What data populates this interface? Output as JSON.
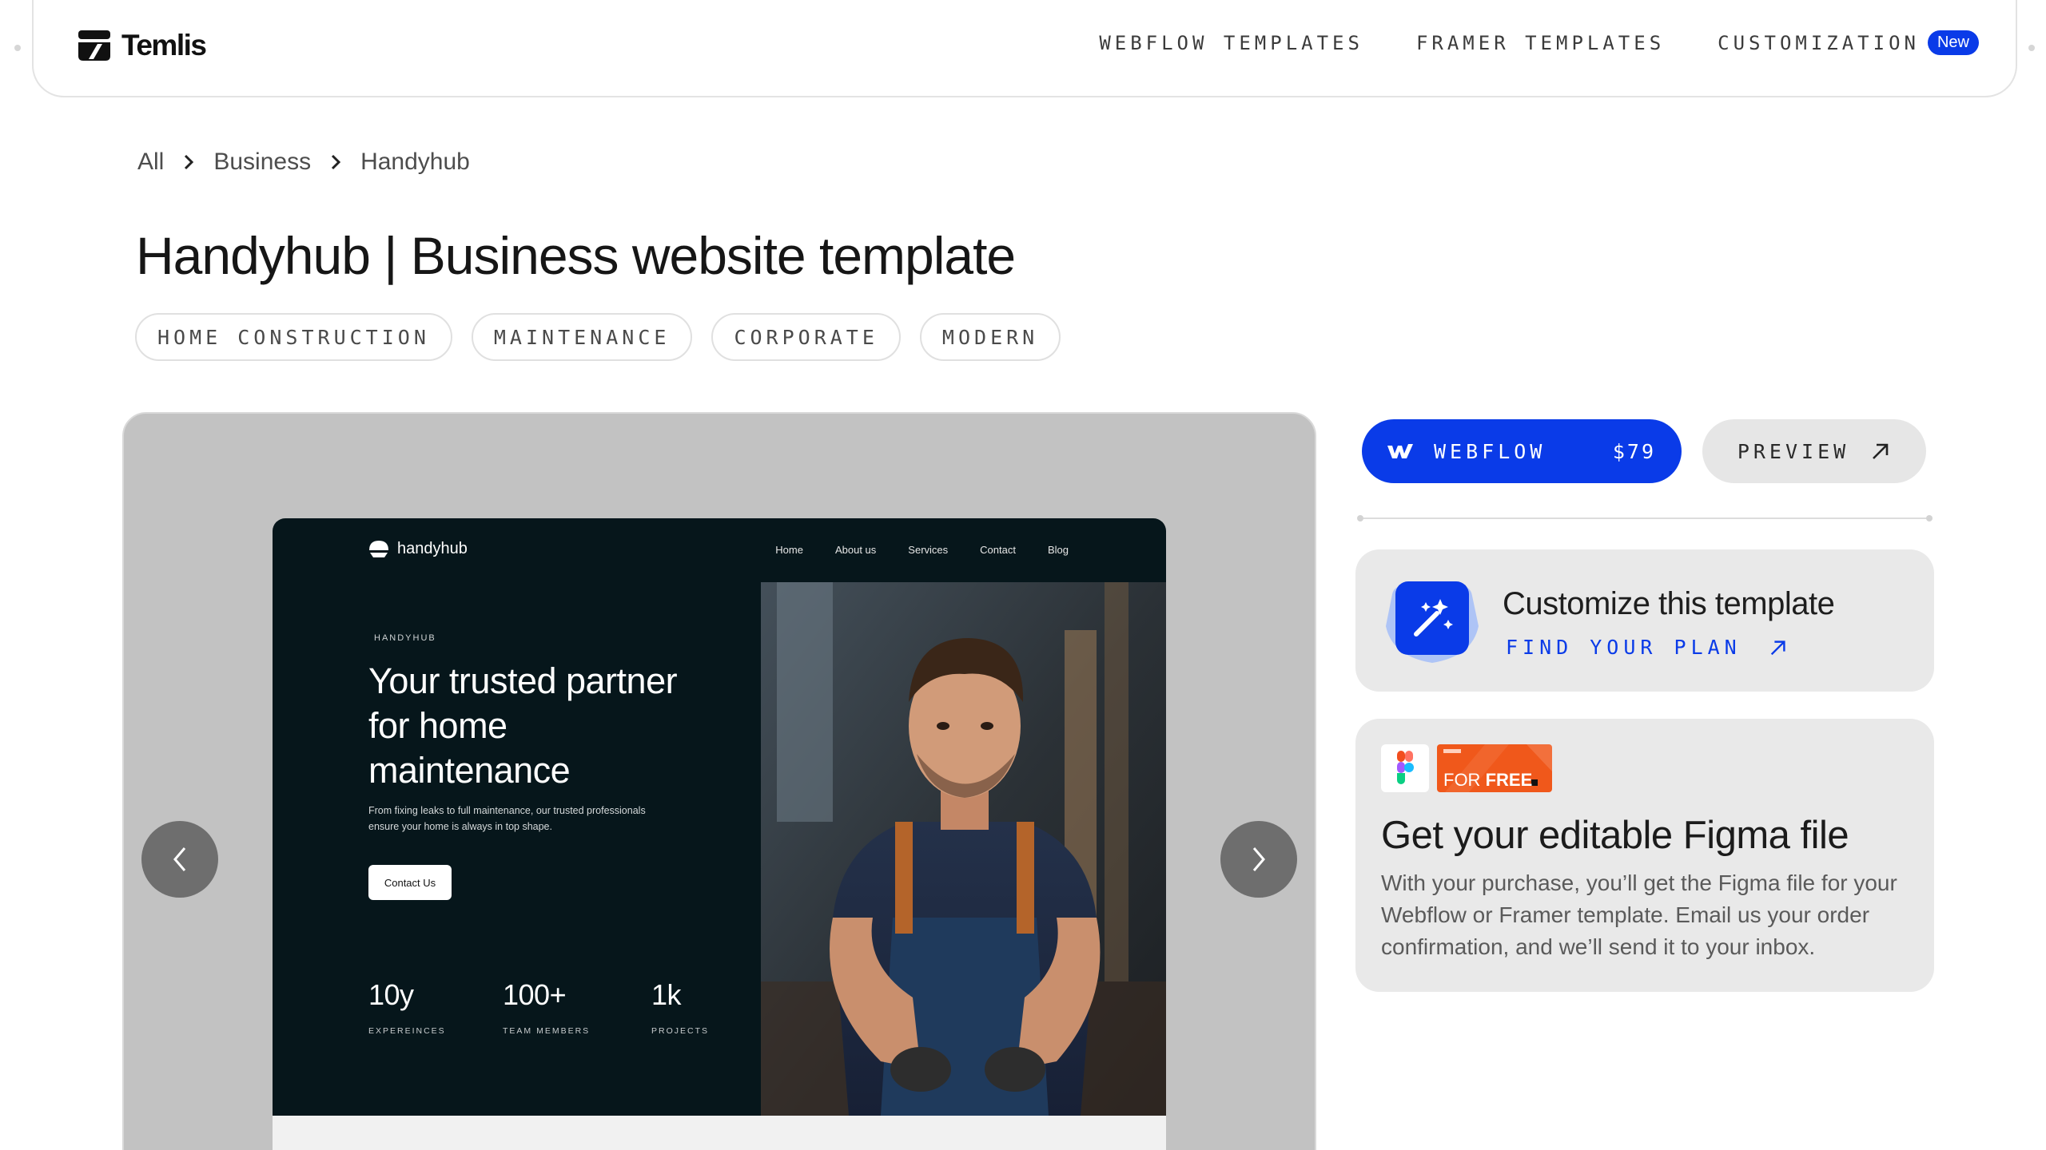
{
  "brand": {
    "name": "Temlis"
  },
  "nav": {
    "links": [
      {
        "label": "WEBFLOW TEMPLATES"
      },
      {
        "label": "FRAMER TEMPLATES"
      },
      {
        "label": "CUSTOMIZATION",
        "badge": "New"
      }
    ]
  },
  "breadcrumb": [
    "All",
    "Business",
    "Handyhub"
  ],
  "page": {
    "title": "Handyhub | Business website template"
  },
  "tags": [
    "HOME CONSTRUCTION",
    "MAINTENANCE",
    "CORPORATE",
    "MODERN"
  ],
  "preview_site": {
    "logo": "handyhub",
    "nav": [
      "Home",
      "About us",
      "Services",
      "Contact",
      "Blog"
    ],
    "eyebrow": "HANDYHUB",
    "headline": "Your trusted partner for home maintenance",
    "body": "From fixing leaks to full maintenance, our trusted professionals ensure your home is always in top shape.",
    "cta": "Contact Us",
    "stats": [
      {
        "value": "10y",
        "label": "EXPEREINCES"
      },
      {
        "value": "100+",
        "label": "TEAM MEMBERS"
      },
      {
        "value": "1k",
        "label": "PROJECTS"
      }
    ]
  },
  "purchase": {
    "platform_label": "WEBFLOW",
    "price": "$79",
    "preview_label": "PREVIEW"
  },
  "customize_card": {
    "title": "Customize this template",
    "link": "FIND YOUR PLAN"
  },
  "figma_card": {
    "tag_prefix": "FOR",
    "tag_emphasis": "FREE",
    "title": "Get your editable Figma file",
    "body": "With your purchase, you’ll get the Figma file for your Webflow or Framer template. Email us your order confirmation, and we’ll send it to your inbox."
  },
  "colors": {
    "accent": "#0a3be8",
    "preview_bg": "#c2c2c2",
    "site_bg": "#06161b",
    "card_bg": "#e9e9e9",
    "free_tag": "#f0581b"
  },
  "icons": [
    "temlis-logo-icon",
    "chevron-right-icon",
    "chevron-left-icon",
    "webflow-icon",
    "arrow-up-right-icon",
    "magic-wand-icon",
    "figma-icon",
    "handyhub-logo-icon"
  ]
}
